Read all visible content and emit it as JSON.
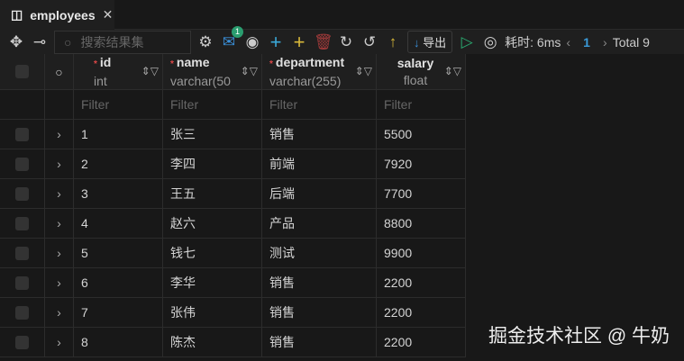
{
  "tab": {
    "title": "employees"
  },
  "toolbar": {
    "search_placeholder": "搜索结果集",
    "notify_count": "1",
    "export_label": "导出",
    "time_label": "耗时: 6ms",
    "page": "1",
    "total": "Total 9"
  },
  "columns": [
    {
      "name": "id",
      "type": "int"
    },
    {
      "name": "name",
      "type": "varchar(50"
    },
    {
      "name": "department",
      "type": "varchar(255)"
    },
    {
      "name": "salary",
      "type": "float"
    }
  ],
  "filter_placeholder": "Filter",
  "rows": [
    [
      "1",
      "张三",
      "销售",
      "5500"
    ],
    [
      "2",
      "李四",
      "前端",
      "7920"
    ],
    [
      "3",
      "王五",
      "后端",
      "7700"
    ],
    [
      "4",
      "赵六",
      "产品",
      "8800"
    ],
    [
      "5",
      "钱七",
      "测试",
      "9900"
    ],
    [
      "6",
      "李华",
      "销售",
      "2200"
    ],
    [
      "7",
      "张伟",
      "销售",
      "2200"
    ],
    [
      "8",
      "陈杰",
      "销售",
      "2200"
    ]
  ],
  "watermark": "掘金技术社区 @ 牛奶"
}
